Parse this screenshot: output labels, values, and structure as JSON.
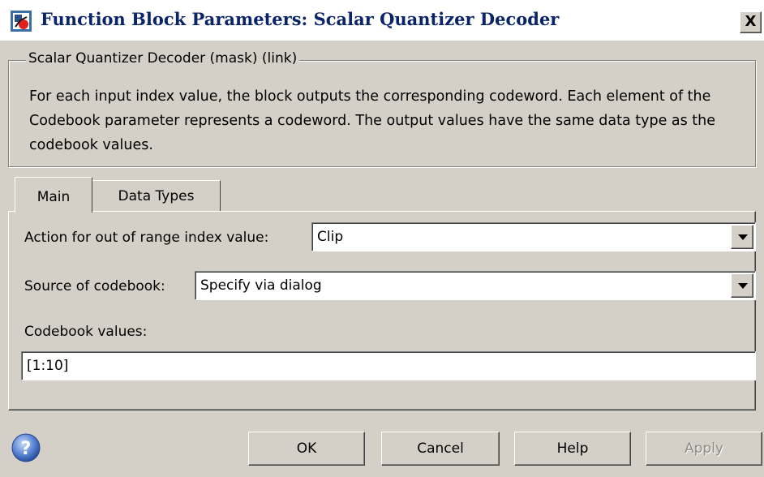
{
  "window": {
    "title": "Function Block Parameters: Scalar Quantizer Decoder",
    "close_label": "X"
  },
  "mask_group": {
    "legend": "Scalar Quantizer Decoder (mask) (link)",
    "description": "For each input index value, the block outputs the corresponding codeword. Each element of the Codebook parameter represents a codeword. The output values have the same data type as the codebook values."
  },
  "tabs": [
    {
      "label": "Main",
      "active": true
    },
    {
      "label": "Data Types",
      "active": false
    }
  ],
  "main": {
    "action_label": "Action for out of range index value:",
    "action_value": "Clip",
    "source_label": "Source of codebook:",
    "source_value": "Specify via dialog",
    "codebook_label": "Codebook values:",
    "codebook_value": "[1:10]"
  },
  "buttons": {
    "ok": "OK",
    "cancel": "Cancel",
    "help": "Help",
    "apply": "Apply",
    "apply_enabled": false
  },
  "icons": {
    "app": "simulink-block-icon",
    "help": "help-question-icon",
    "dropdown": "chevron-down-icon"
  }
}
